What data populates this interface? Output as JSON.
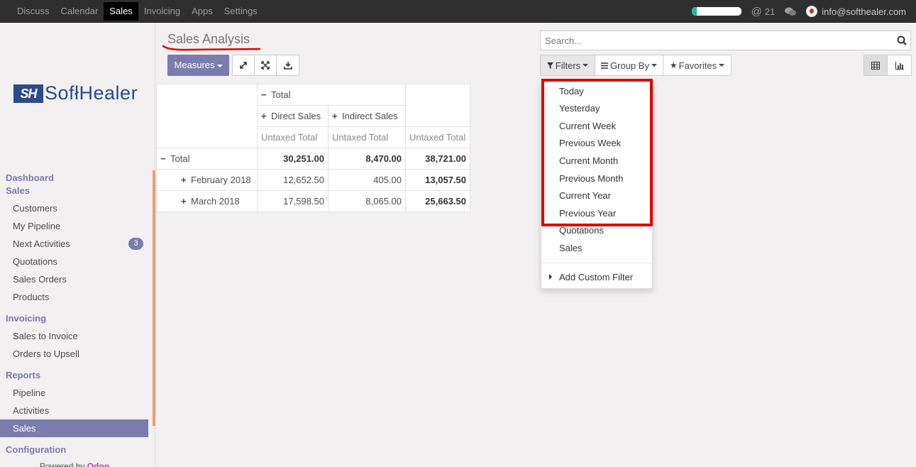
{
  "topbar": {
    "menu": [
      "Discuss",
      "Calendar",
      "Sales",
      "Invoicing",
      "Apps",
      "Settings"
    ],
    "active_menu": "Sales",
    "mentions_count": "21",
    "user_email": "info@softhealer.com",
    "progress": 0.1
  },
  "logo": {
    "mark": "SH",
    "word": "SofłHealer"
  },
  "sidebar": {
    "sections": [
      {
        "title": "Dashboard",
        "items": []
      },
      {
        "title": "Sales",
        "items": [
          {
            "label": "Customers"
          },
          {
            "label": "My Pipeline"
          },
          {
            "label": "Next Activities",
            "badge": "3"
          },
          {
            "label": "Quotations"
          },
          {
            "label": "Sales Orders"
          },
          {
            "label": "Products"
          }
        ]
      },
      {
        "title": "Invoicing",
        "items": [
          {
            "label": "Sales to Invoice"
          },
          {
            "label": "Orders to Upsell"
          }
        ]
      },
      {
        "title": "Reports",
        "items": [
          {
            "label": "Pipeline"
          },
          {
            "label": "Activities"
          },
          {
            "label": "Sales",
            "active": true
          }
        ]
      },
      {
        "title": "Configuration",
        "items": []
      }
    ],
    "powered_by": "Powered by",
    "powered_brand": "Odoo"
  },
  "breadcrumb": "Sales Analysis",
  "toolbar": {
    "measures_label": "Measures",
    "filters_label": "Filters",
    "groupby_label": "Group By",
    "favorites_label": "Favorites"
  },
  "search": {
    "placeholder": "Search..."
  },
  "pivot": {
    "col_total": "Total",
    "col_direct": "Direct Sales",
    "col_indirect": "Indirect Sales",
    "measure": "Untaxed Total",
    "rows": [
      {
        "label": "Total",
        "sign": "−",
        "direct": "30,251.00",
        "indirect": "8,470.00",
        "total": "38,721.00"
      },
      {
        "label": "February 2018",
        "sign": "+",
        "direct": "12,652.50",
        "indirect": "405.00",
        "total": "13,057.50"
      },
      {
        "label": "March 2018",
        "sign": "+",
        "direct": "17,598.50",
        "indirect": "8,065.00",
        "total": "25,663.50"
      }
    ]
  },
  "filters_dropdown": {
    "options": [
      "Today",
      "Yesterday",
      "Current Week",
      "Previous Week",
      "Current Month",
      "Previous Month",
      "Current Year",
      "Previous Year",
      "Quotations",
      "Sales"
    ],
    "custom": "Add Custom Filter"
  },
  "colors": {
    "accent": "#7c7bad",
    "highlight": "#e00000",
    "topbar": "#2f2f2f"
  }
}
